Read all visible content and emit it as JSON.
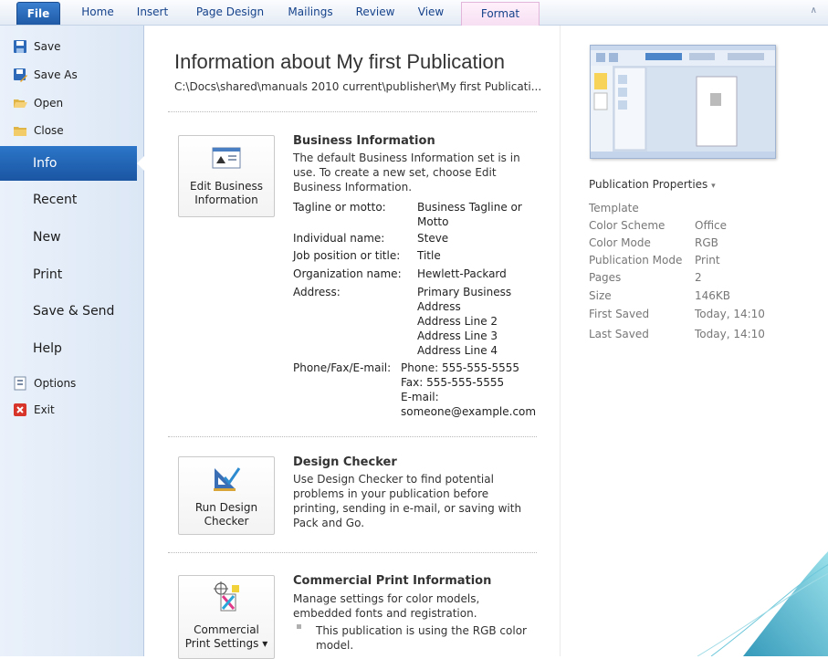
{
  "ribbon": {
    "tabs": [
      "File",
      "Home",
      "Insert",
      "Page Design",
      "Mailings",
      "Review",
      "View",
      "Format"
    ],
    "minimize_icon": "chevron-up-icon"
  },
  "nav": {
    "save": "Save",
    "save_as": "Save As",
    "open": "Open",
    "close": "Close",
    "info": "Info",
    "recent": "Recent",
    "new": "New",
    "print": "Print",
    "save_send": "Save & Send",
    "help": "Help",
    "options": "Options",
    "exit": "Exit"
  },
  "info": {
    "title": "Information about My first Publication",
    "path": "C:\\Docs\\shared\\manuals 2010 current\\publisher\\My first Publicati..."
  },
  "business": {
    "button_line1": "Edit Business",
    "button_line2": "Information",
    "heading": "Business Information",
    "desc": "The default Business Information set is in use. To create a new set, choose Edit Business Information.",
    "fields": [
      {
        "key": "Tagline or motto:",
        "value": "Business Tagline or Motto"
      },
      {
        "key": "Individual name:",
        "value": "Steve"
      },
      {
        "key": "Job position or title:",
        "value": "Title"
      },
      {
        "key": "Organization name:",
        "value": "Hewlett-Packard"
      },
      {
        "key": "Address:",
        "value_lines": [
          "Primary Business",
          "Address",
          "Address Line 2",
          "Address Line 3",
          "Address Line 4"
        ]
      },
      {
        "key": "Phone/Fax/E-mail:",
        "value_lines": [
          "Phone: 555-555-5555",
          "Fax: 555-555-5555",
          "E-mail:",
          "someone@example.com"
        ]
      }
    ]
  },
  "design_checker": {
    "button_line1": "Run Design",
    "button_line2": "Checker",
    "heading": "Design Checker",
    "desc": "Use Design Checker to find potential problems in your publication before printing, sending in e-mail, or saving with Pack and Go."
  },
  "commercial": {
    "button_line1": "Commercial",
    "button_line2": "Print Settings",
    "button_arrow": "▾",
    "heading": "Commercial Print Information",
    "desc": "Manage settings for color models, embedded fonts and registration.",
    "bullet": "This publication is using the RGB color model."
  },
  "properties": {
    "header": "Publication Properties",
    "header_arrow": "▾",
    "items": [
      {
        "key": "Template",
        "value": ""
      },
      {
        "key": "Color Scheme",
        "value": "Office"
      },
      {
        "key": "Color Mode",
        "value": "RGB"
      },
      {
        "key": "Publication Mode",
        "value": "Print"
      },
      {
        "key": "Pages",
        "value": "2"
      },
      {
        "key": "Size",
        "value": "146KB"
      },
      {
        "key": "First Saved",
        "value": "Today, 14:10"
      },
      {
        "key": "Last Saved",
        "value": "Today, 14:10"
      }
    ]
  },
  "colors": {
    "accent": "#1f5aa6",
    "nav_bg": "#dce7f5",
    "swoosh": "#3aa5c6"
  }
}
